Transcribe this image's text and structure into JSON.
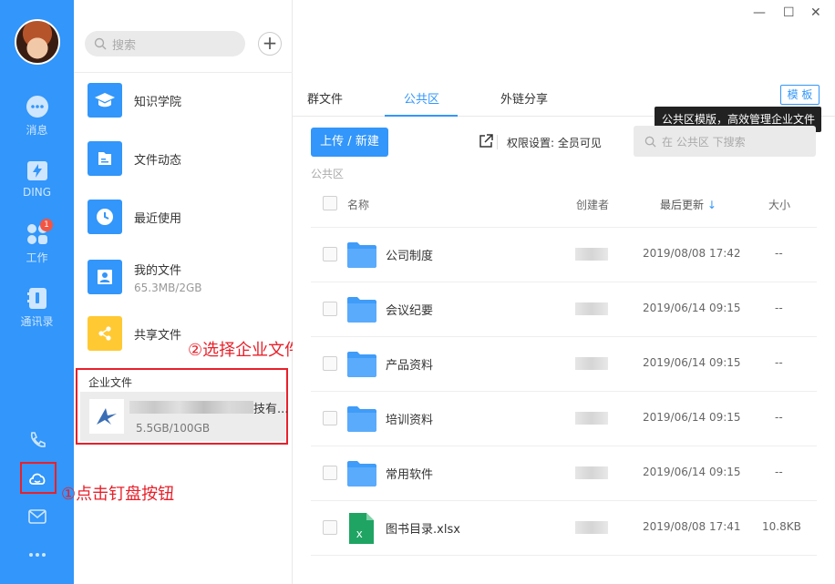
{
  "nav": {
    "items": [
      {
        "label": "消息",
        "icon": "chat-icon"
      },
      {
        "label": "DING",
        "icon": "ding-icon"
      },
      {
        "label": "工作",
        "icon": "work-icon",
        "badge": "1"
      },
      {
        "label": "通讯录",
        "icon": "contacts-icon"
      }
    ],
    "bottom_icons": [
      "phone-icon",
      "cloud-drive-icon",
      "mail-icon",
      "more-icon"
    ]
  },
  "panel2": {
    "search_placeholder": "搜索",
    "items": [
      {
        "title": "知识学院",
        "icon": "academy-icon"
      },
      {
        "title": "文件动态",
        "icon": "file-activity-icon"
      },
      {
        "title": "最近使用",
        "icon": "clock-icon"
      },
      {
        "title": "我的文件",
        "subtitle": "65.3MB/2GB",
        "icon": "user-file-icon"
      },
      {
        "title": "共享文件",
        "icon": "share-icon"
      }
    ],
    "enterprise": {
      "section_label": "企业文件",
      "name_suffix": "技有...",
      "size": "5.5GB/100GB"
    }
  },
  "annotations": {
    "step1": "①点击钉盘按钮",
    "step2": "②选择企业文件"
  },
  "main": {
    "tabs": [
      "群文件",
      "公共区",
      "外链分享"
    ],
    "active_tab": 1,
    "template_button": "模 板",
    "tooltip": "公共区模版，高效管理企业文件",
    "upload_button": "上传 / 新建",
    "permission": "权限设置: 全员可见",
    "search_placeholder": "在 公共区 下搜索",
    "breadcrumb": "公共区",
    "columns": {
      "name": "名称",
      "creator": "创建者",
      "updated": "最后更新",
      "size": "大小"
    },
    "files": [
      {
        "name": "公司制度",
        "date": "2019/08/08 17:42",
        "size": "--",
        "type": "folder"
      },
      {
        "name": "会议纪要",
        "date": "2019/06/14 09:15",
        "size": "--",
        "type": "folder"
      },
      {
        "name": "产品资料",
        "date": "2019/06/14 09:15",
        "size": "--",
        "type": "folder"
      },
      {
        "name": "培训资料",
        "date": "2019/06/14 09:15",
        "size": "--",
        "type": "folder"
      },
      {
        "name": "常用软件",
        "date": "2019/06/14 09:15",
        "size": "--",
        "type": "folder"
      },
      {
        "name": "图书目录.xlsx",
        "date": "2019/08/08 17:41",
        "size": "10.8KB",
        "type": "xlsx"
      }
    ]
  },
  "colors": {
    "accent": "#3296fa",
    "annotation": "#e8202a",
    "share": "#ffc933"
  }
}
